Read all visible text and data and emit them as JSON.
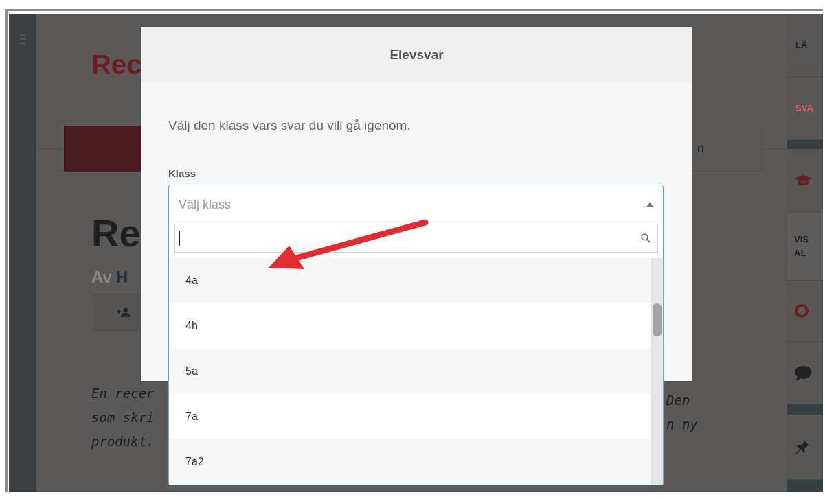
{
  "page": {
    "header_title": "Rec",
    "title": "Re",
    "byline": {
      "prefix": "Av",
      "author": "H"
    },
    "tab_fragment": "n",
    "intro_left": [
      "En recer",
      "som skri",
      "produkt."
    ],
    "intro_right": [
      "Den",
      "n ny"
    ]
  },
  "sidebar": {
    "tabs": [
      {
        "label": "LÄ",
        "selected": false
      },
      {
        "label": "SVA",
        "selected": true
      }
    ],
    "toggle_lines": [
      "VIS",
      "AL"
    ]
  },
  "modal": {
    "title": "Elevsvar",
    "instruction": "Välj den klass vars svar du vill gå igenom.",
    "field_label": "Klass",
    "select": {
      "placeholder": "Välj klass",
      "expanded": true,
      "options": [
        {
          "label": "4a",
          "selected": false
        },
        {
          "label": "4h",
          "selected": false
        },
        {
          "label": "5a",
          "selected": false
        },
        {
          "label": "7a",
          "selected": false
        },
        {
          "label": "7a2",
          "selected": false
        }
      ]
    }
  }
}
